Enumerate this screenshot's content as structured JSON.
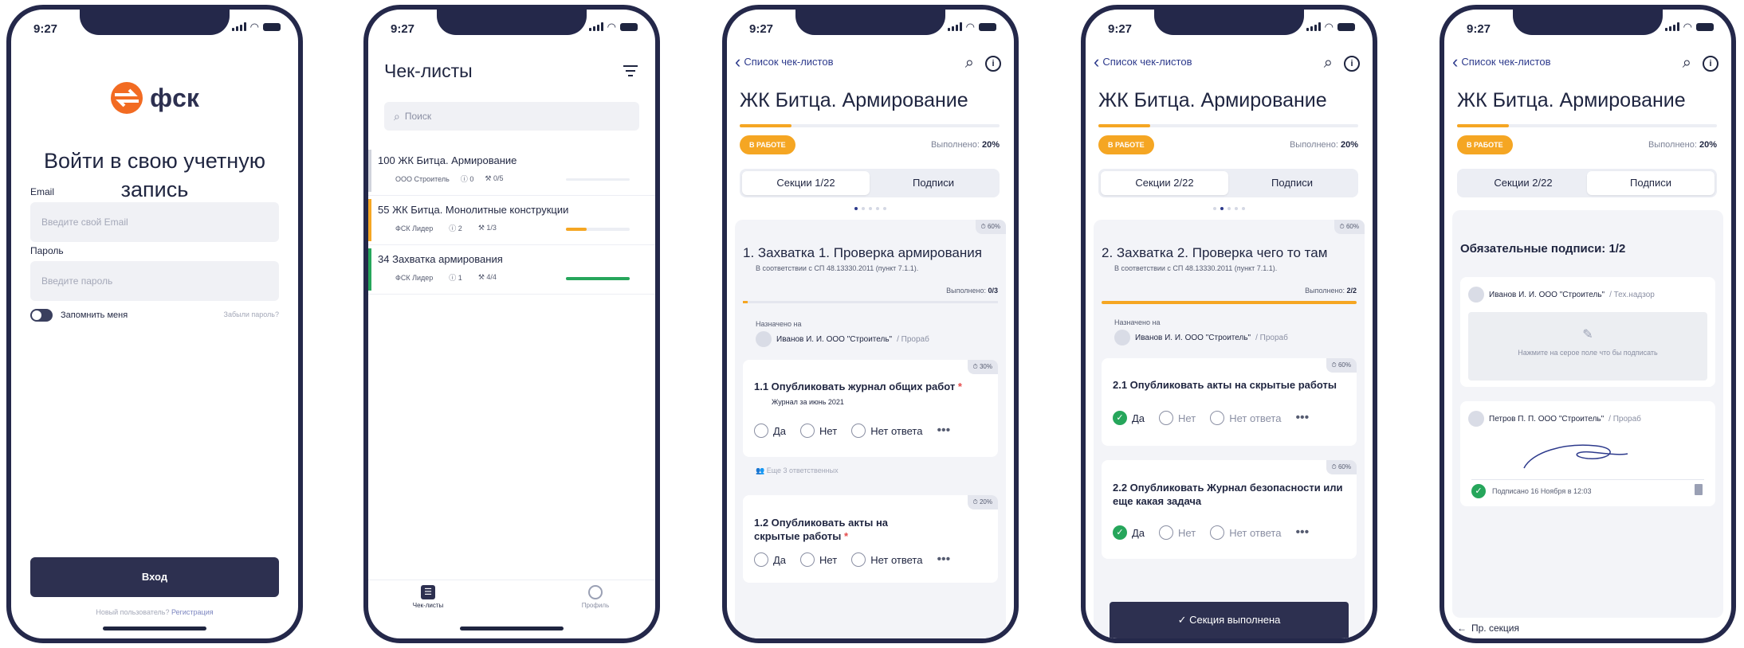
{
  "status": {
    "time": "9:27"
  },
  "login": {
    "logo_text": "фск",
    "title": "Войти в свою учетную запись",
    "email_label": "Email",
    "email_placeholder": "Введите свой Email",
    "password_label": "Пароль",
    "password_placeholder": "Введите пароль",
    "remember": "Запомнить меня",
    "forgot": "Забыли пароль?",
    "login_button": "Вход",
    "new_user": "Новый пользователь?",
    "register": "Регистрация"
  },
  "list": {
    "title": "Чек-листы",
    "search_placeholder": "Поиск",
    "items": [
      {
        "num": "100",
        "title": "ЖК Битца. Армирование",
        "org": "ООО Строитель",
        "issues": "0",
        "tasks": "0/5",
        "progress": 0,
        "stripe": "#d0d3db"
      },
      {
        "num": "55",
        "title": "ЖК Битца. Монолитные конструкции",
        "org": "ФСК Лидер",
        "issues": "2",
        "tasks": "1/3",
        "progress": 0.33,
        "stripe": "#f5a623"
      },
      {
        "num": "34",
        "title": "Захватка армирования",
        "org": "ФСК Лидер",
        "issues": "1",
        "tasks": "4/4",
        "progress": 1,
        "stripe": "#26a65b"
      }
    ],
    "tab_checklists": "Чек-листы",
    "tab_profile": "Профиль"
  },
  "detail": {
    "back": "Список чек-листов",
    "title": "ЖК Битца. Армирование",
    "status_pill": "В РАБОТЕ",
    "done_label": "Выполнено:",
    "done_value": "20%",
    "tab_sections_1": "Секции 1/22",
    "tab_sections_2": "Секции 2/22",
    "tab_signatures": "Подписи",
    "timer": "60%",
    "timer_30": "30%",
    "timer_20": "20%",
    "yes": "Да",
    "no": "Нет",
    "no_answer": "Нет ответа",
    "assigned_label": "Назначено на",
    "assignee": "Иванов И. И. ООО \"Строитель\"",
    "assignee_role": "/ Прораб"
  },
  "screen3": {
    "section_title": "1.  Захватка 1. Проверка армирования",
    "section_sub": "В соответствии с СП 48.13330.2011 (пункт 7.1.1).",
    "section_done": "0/3",
    "q1_title": "1.1  Опубликовать журнал общих работ",
    "q1_sub": "Журнал за июнь 2021",
    "more_resp": "Еще 3 ответственных",
    "q2_title": "1.2  Опубликовать акты на скрытые работы"
  },
  "screen4": {
    "section_title": "2.  Захватка 2. Проверка чего то там",
    "section_sub": "В соответствии с СП 48.13330.2011 (пункт 7.1.1).",
    "section_done": "2/2",
    "q1_title": "2.1  Опубликовать акты на скрытые работы",
    "q2_title": "2.2  Опубликовать Журнал безопасности или еще какая задача",
    "complete_button": "Секция выполнена"
  },
  "screen5": {
    "required_title": "Обязательные подписи: 1/2",
    "signer1": "Иванов И. И. ООО \"Строитель\"",
    "signer1_role": "/ Тех.надзор",
    "sign_hint": "Нажмите на серое поле что бы подписать",
    "signer2": "Петров П. П. ООО \"Строитель\"",
    "signer2_role": "/ Прораб",
    "signed_text": "Подписано 16 Ноября в 12:03",
    "prev_section": "Пр. секция"
  },
  "colors": {
    "accent": "#f5a623",
    "navy": "#2d3a8c",
    "dark": "#2d3050",
    "green": "#26a65b"
  }
}
